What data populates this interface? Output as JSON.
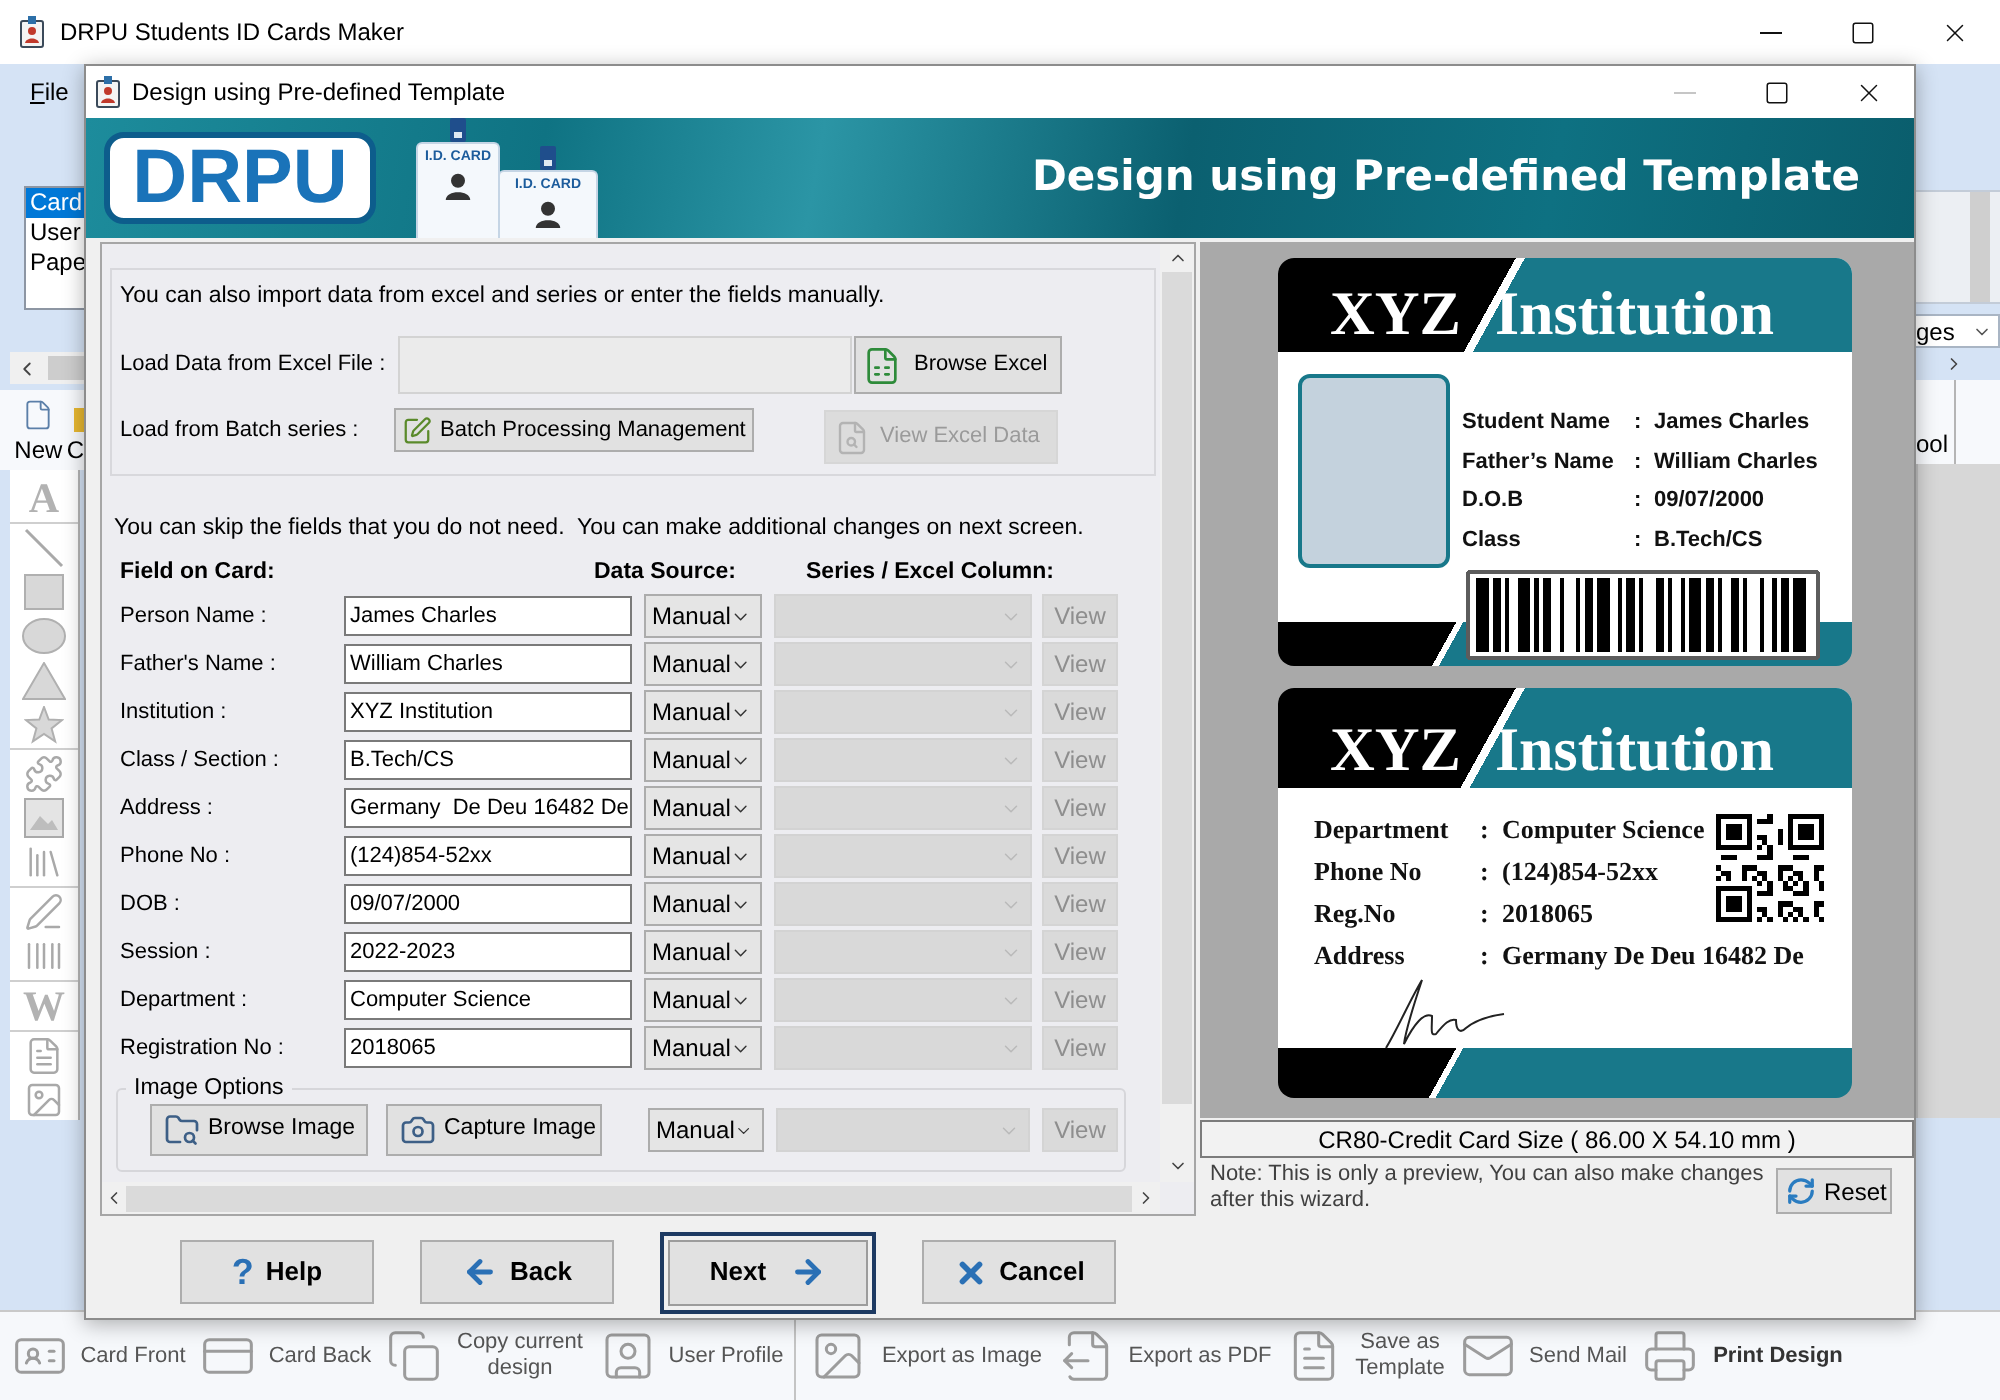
{
  "app": {
    "title": "DRPU Students ID Cards Maker",
    "controls": [
      {
        "kind": "minimize",
        "disabled": false
      },
      {
        "kind": "maximize",
        "disabled": false
      },
      {
        "kind": "close",
        "disabled": false
      }
    ],
    "menu": [
      "File"
    ],
    "list": [
      {
        "label": "Card",
        "selected": true
      },
      {
        "label": "User",
        "selected": false
      },
      {
        "label": "Pape",
        "selected": false
      }
    ],
    "toolbar": [
      {
        "kind": "new",
        "label": "New"
      },
      {
        "kind": "folder",
        "label": "C"
      }
    ],
    "tools": [
      [
        {
          "kind": "glyph",
          "glyph": "A"
        }
      ],
      [
        {
          "kind": "line"
        },
        {
          "kind": "rectangle"
        },
        {
          "kind": "ellipse"
        },
        {
          "kind": "triangle"
        },
        {
          "kind": "star"
        }
      ],
      [
        {
          "kind": "burst"
        },
        {
          "kind": "picture"
        },
        {
          "kind": "books"
        }
      ],
      [
        {
          "kind": "pen"
        },
        {
          "kind": "barcode"
        }
      ],
      [
        {
          "kind": "glyph",
          "glyph": "W"
        }
      ],
      [
        {
          "kind": "document"
        },
        {
          "kind": "image"
        }
      ]
    ],
    "side_combo": "ges",
    "side_toolbar": "ool"
  },
  "dialog": {
    "title": "Design using Pre-defined Template",
    "controls": [
      {
        "kind": "minimize",
        "disabled": true
      },
      {
        "kind": "maximize",
        "disabled": false
      },
      {
        "kind": "close",
        "disabled": false
      }
    ],
    "banner": {
      "logo": "DRPU",
      "badges": [
        "I.D. CARD",
        "I.D. CARD"
      ],
      "heading": "Design using Pre-defined Template"
    },
    "import": {
      "intro": "You can also import data from excel and series or enter the fields manually.",
      "excel_label": "Load Data from Excel File :",
      "browse_excel": "Browse Excel",
      "batch_label": "Load from Batch series :",
      "batch_button": "Batch Processing Management",
      "view_excel": {
        "label": "View Excel Data",
        "disabled": true
      }
    },
    "fields": {
      "note": "You can skip the fields that you do not need.  You can make additional changes on next screen.",
      "headers": [
        "Field on Card:",
        "Data Source:",
        "Series / Excel Column:"
      ],
      "rows": [
        {
          "label": "Person Name :",
          "value": "James Charles",
          "source": "Manual",
          "series": {
            "disabled": true
          },
          "view": {
            "label": "View",
            "disabled": true
          }
        },
        {
          "label": "Father's Name :",
          "value": "William Charles",
          "source": "Manual",
          "series": {
            "disabled": true
          },
          "view": {
            "label": "View",
            "disabled": true
          }
        },
        {
          "label": "Institution :",
          "value": "XYZ Institution",
          "source": "Manual",
          "series": {
            "disabled": true
          },
          "view": {
            "label": "View",
            "disabled": true
          }
        },
        {
          "label": "Class / Section :",
          "value": "B.Tech/CS",
          "source": "Manual",
          "series": {
            "disabled": true
          },
          "view": {
            "label": "View",
            "disabled": true
          }
        },
        {
          "label": "Address :",
          "value": "Germany  De Deu 16482 De",
          "source": "Manual",
          "series": {
            "disabled": true
          },
          "view": {
            "label": "View",
            "disabled": true
          }
        },
        {
          "label": "Phone No :",
          "value": "(124)854-52xx",
          "source": "Manual",
          "series": {
            "disabled": true
          },
          "view": {
            "label": "View",
            "disabled": true
          }
        },
        {
          "label": "DOB :",
          "value": "09/07/2000",
          "source": "Manual",
          "series": {
            "disabled": true
          },
          "view": {
            "label": "View",
            "disabled": true
          }
        },
        {
          "label": "Session :",
          "value": "2022-2023",
          "source": "Manual",
          "series": {
            "disabled": true
          },
          "view": {
            "label": "View",
            "disabled": true
          }
        },
        {
          "label": "Department :",
          "value": "Computer Science",
          "source": "Manual",
          "series": {
            "disabled": true
          },
          "view": {
            "label": "View",
            "disabled": true
          }
        },
        {
          "label": "Registration No :",
          "value": "2018065",
          "source": "Manual",
          "series": {
            "disabled": true
          },
          "view": {
            "label": "View",
            "disabled": true
          }
        }
      ],
      "image_options": {
        "title": "Image Options",
        "browse": "Browse Image",
        "capture": "Capture Image",
        "source": "Manual",
        "series": {
          "disabled": true
        },
        "view": {
          "label": "View",
          "disabled": true
        }
      }
    },
    "preview": {
      "front": {
        "org": "XYZ",
        "name": "Institution",
        "rows": [
          {
            "label": "Student Name",
            "sep": ":",
            "value": "James Charles"
          },
          {
            "label": "Father’s Name",
            "sep": ":",
            "value": "William Charles"
          },
          {
            "label": "D.O.B",
            "sep": ":",
            "value": "09/07/2000"
          },
          {
            "label": "Class",
            "sep": ":",
            "value": "B.Tech/CS"
          }
        ]
      },
      "back": {
        "org": "XYZ",
        "name": "Institution",
        "rows": [
          {
            "label": "Department",
            "sep": ":",
            "value": "Computer Science"
          },
          {
            "label": "Phone No",
            "sep": ":",
            "value": "(124)854-52xx"
          },
          {
            "label": "Reg.No",
            "sep": ":",
            "value": "2018065"
          },
          {
            "label": "Address",
            "sep": ":",
            "value": "Germany De Deu 16482 De"
          }
        ]
      },
      "size": "CR80-Credit Card Size ( 86.00 X 54.10 mm )",
      "note": "Note: This is only a preview, You can also make changes after this wizard.",
      "reset": "Reset"
    },
    "buttons": [
      {
        "kind": "help",
        "icon": "?",
        "label": "Help",
        "focused": false
      },
      {
        "kind": "back",
        "label": "Back",
        "focused": false
      },
      {
        "kind": "next",
        "label": "Next",
        "focused": true
      },
      {
        "kind": "cancel",
        "label": "Cancel",
        "focused": false
      }
    ]
  },
  "taskbar": [
    [
      {
        "kind": "card_front",
        "label": "Card Front",
        "emphasized": false
      },
      {
        "kind": "card_back",
        "label": "Card Back",
        "emphasized": false
      },
      {
        "kind": "copy",
        "label": "Copy current design",
        "emphasized": false
      },
      {
        "kind": "profile",
        "label": "User Profile",
        "emphasized": false
      }
    ],
    [
      {
        "kind": "export_image",
        "label": "Export as Image",
        "emphasized": false
      },
      {
        "kind": "export_pdf",
        "label": "Export as PDF",
        "emphasized": false
      },
      {
        "kind": "template",
        "label": "Save as Template",
        "emphasized": false
      },
      {
        "kind": "mail",
        "label": "Send Mail",
        "emphasized": false
      },
      {
        "kind": "print",
        "label": "Print Design",
        "emphasized": true
      }
    ]
  ]
}
